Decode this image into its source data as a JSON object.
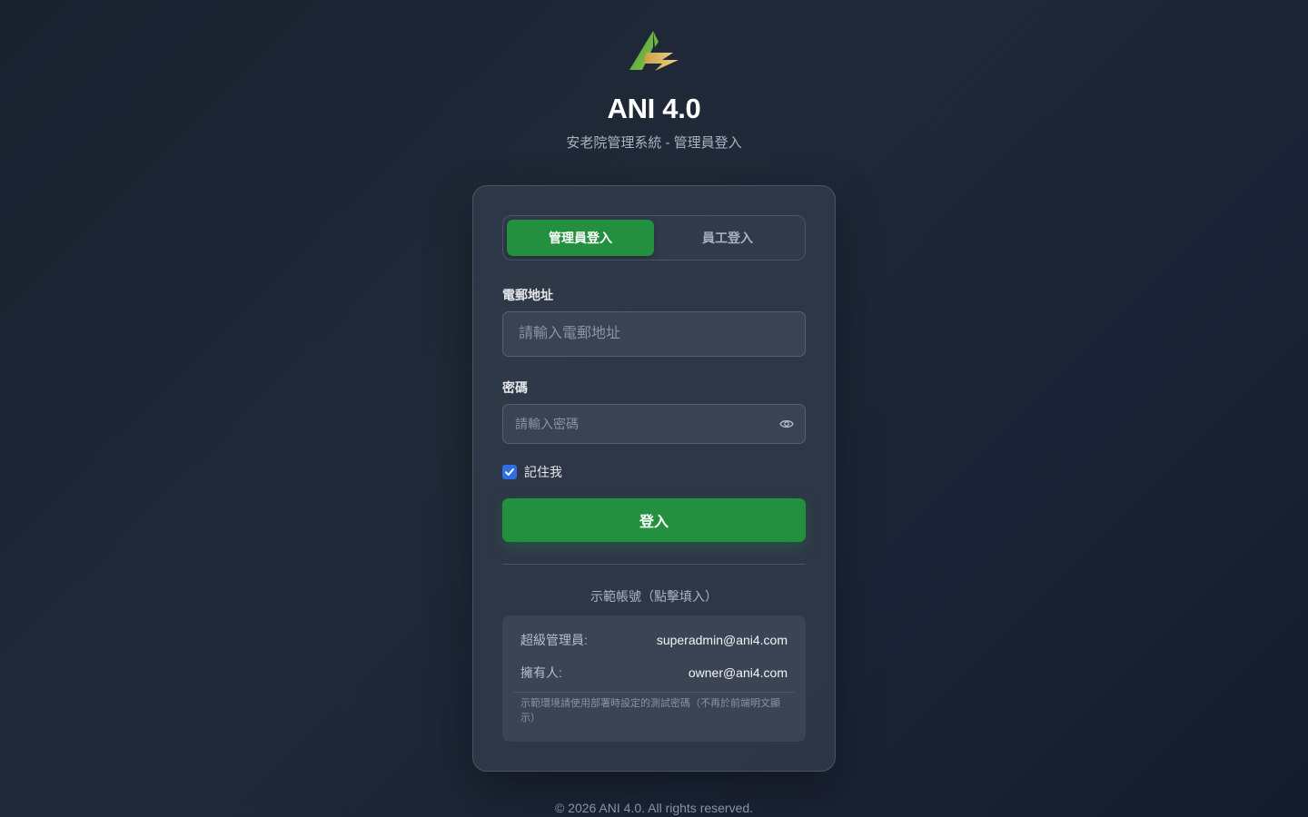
{
  "header": {
    "logo_icon": "ani-a-logo-icon",
    "title": "ANI 4.0",
    "subtitle": "安老院管理系統 - 管理員登入"
  },
  "tabs": [
    {
      "label": "管理員登入",
      "active": true
    },
    {
      "label": "員工登入",
      "active": false
    }
  ],
  "form": {
    "email_label": "電郵地址",
    "email_placeholder": "請輸入電郵地址",
    "email_value": "",
    "password_label": "密碼",
    "password_placeholder": "請輸入密碼",
    "password_value": "",
    "show_password_icon": "eye-icon",
    "remember_label": "記住我",
    "remember_checked": true,
    "submit_label": "登入"
  },
  "demo": {
    "title": "示範帳號（點擊填入）",
    "accounts": [
      {
        "role": "超級管理員:",
        "email": "superadmin@ani4.com"
      },
      {
        "role": "擁有人:",
        "email": "owner@ani4.com"
      }
    ],
    "note": "示範環境請使用部署時設定的測試密碼（不再於前端明文顯示）"
  },
  "footer": {
    "text": "© 2026 ANI 4.0. All rights reserved."
  },
  "colors": {
    "accent_green": "#22903f",
    "checkbox_blue": "#2f6fe4",
    "card_bg": "#333c4c",
    "page_bg": "#1f2937"
  }
}
